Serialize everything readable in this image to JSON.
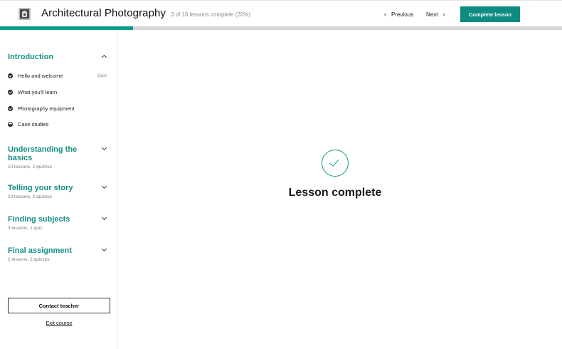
{
  "header": {
    "logo_icon": "camera-icon",
    "course_title": "Architectural Photography",
    "progress_text": "3 of 10 lessons complete (20%)",
    "progress_fraction": 0.2366,
    "previous_label": "Previous",
    "next_label": "Next",
    "complete_button_label": "Complete lesson",
    "accent_color": "#0e8c81"
  },
  "sidebar": {
    "sections": [
      {
        "title": "Introduction",
        "meta": "",
        "expanded": true
      },
      {
        "title": "Understanding the basics",
        "meta": "10 lessons, 2 quizzes",
        "expanded": false
      },
      {
        "title": "Telling your story",
        "meta": "10 lessons, 2 quizzes",
        "expanded": false
      },
      {
        "title": "Finding subjects",
        "meta": "3 lessons, 1 quiz",
        "expanded": false
      },
      {
        "title": "Final assignment",
        "meta": "2 lessons, 2 quizzes",
        "expanded": false
      }
    ],
    "lessons": [
      {
        "label": "Hello and welcome",
        "tag": "Quiz",
        "status": "complete"
      },
      {
        "label": "What you'll learn",
        "tag": "",
        "status": "complete"
      },
      {
        "label": "Photography equipment",
        "tag": "",
        "status": "complete"
      },
      {
        "label": "Case studies",
        "tag": "",
        "status": "in-progress"
      }
    ],
    "contact_label": "Contact teacher",
    "exit_label": "Exit course"
  },
  "main": {
    "heading": "Lesson complete",
    "icon": "check-circle-icon"
  }
}
